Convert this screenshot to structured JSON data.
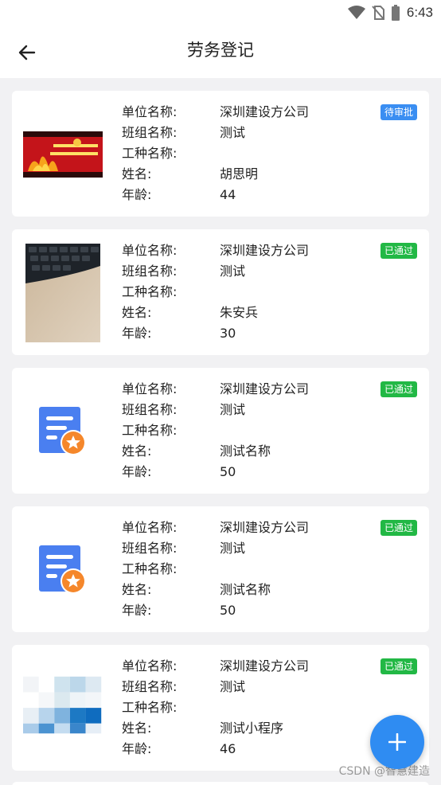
{
  "status_bar": {
    "time": "6:43"
  },
  "header": {
    "title": "劳务登记"
  },
  "labels": {
    "unit": "单位名称:",
    "team": "班组名称:",
    "trade": "工种名称:",
    "name": "姓名:",
    "age": "年龄:"
  },
  "records": [
    {
      "unit": "深圳建设方公司",
      "team": "测试",
      "trade": "",
      "name": "胡思明",
      "age": "44",
      "status": "待审批",
      "status_color": "#3a8ef2",
      "thumb": "poster-image"
    },
    {
      "unit": "深圳建设方公司",
      "team": "测试",
      "trade": "",
      "name": "朱安兵",
      "age": "30",
      "status": "已通过",
      "status_color": "#22b845",
      "thumb": "keyboard-photo"
    },
    {
      "unit": "深圳建设方公司",
      "team": "测试",
      "trade": "",
      "name": "测试名称",
      "age": "50",
      "status": "已通过",
      "status_color": "#22b845",
      "thumb": "document-star-icon"
    },
    {
      "unit": "深圳建设方公司",
      "team": "测试",
      "trade": "",
      "name": "测试名称",
      "age": "50",
      "status": "已通过",
      "status_color": "#22b845",
      "thumb": "document-star-icon"
    },
    {
      "unit": "深圳建设方公司",
      "team": "测试",
      "trade": "",
      "name": "测试小程序",
      "age": "46",
      "status": "已通过",
      "status_color": "#22b845",
      "thumb": "pixelated-image"
    }
  ],
  "fab": {
    "icon": "plus-icon"
  },
  "watermark": "CSDN @智慧建造"
}
